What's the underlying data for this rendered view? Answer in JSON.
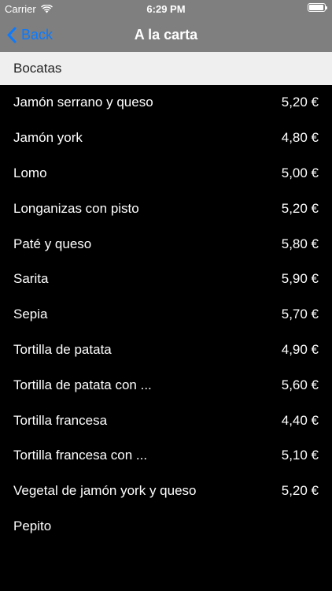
{
  "status_bar": {
    "carrier": "Carrier",
    "time": "6:29 PM",
    "battery_level": 0.95
  },
  "nav": {
    "back_label": "Back",
    "title": "A la carta"
  },
  "section": {
    "title": "Bocatas"
  },
  "items": [
    {
      "name": "Jamón serrano y queso",
      "price": "5,20 €"
    },
    {
      "name": "Jamón york",
      "price": "4,80 €"
    },
    {
      "name": "Lomo",
      "price": "5,00 €"
    },
    {
      "name": "Longanizas con pisto",
      "price": "5,20 €"
    },
    {
      "name": "Paté y queso",
      "price": "5,80 €"
    },
    {
      "name": "Sarita",
      "price": "5,90 €"
    },
    {
      "name": "Sepia",
      "price": "5,70 €"
    },
    {
      "name": "Tortilla de patata",
      "price": "4,90 €"
    },
    {
      "name": "Tortilla de patata con ...",
      "price": "5,60 €"
    },
    {
      "name": "Tortilla francesa",
      "price": "4,40 €"
    },
    {
      "name": "Tortilla francesa con ...",
      "price": "5,10 €"
    },
    {
      "name": "Vegetal de jamón york y queso",
      "price": "5,20 €"
    },
    {
      "name": "Pepito",
      "price": ""
    }
  ],
  "colors": {
    "nav_background": "#7f7f7f",
    "accent": "#0a7aff",
    "section_background": "#efefef",
    "list_background": "#000000"
  },
  "icons": {
    "wifi": "wifi-icon",
    "battery": "battery-icon",
    "back": "chevron-left-icon"
  }
}
